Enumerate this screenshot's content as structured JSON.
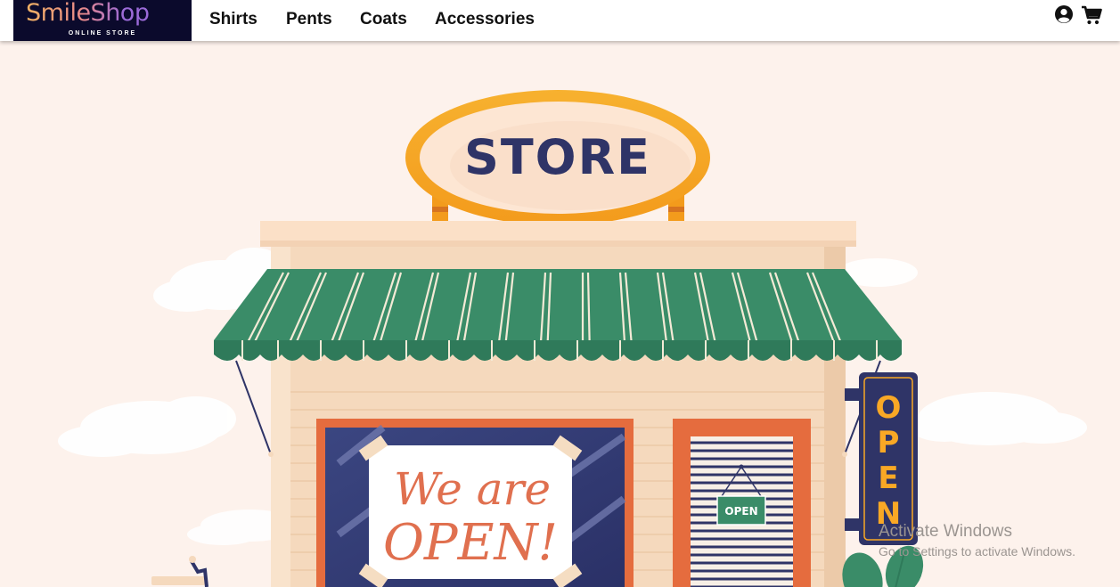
{
  "nav": {
    "logo_title": "SmileShop",
    "logo_subtitle": "ONLINE STORE",
    "links": [
      "Shirts",
      "Pents",
      "Coats",
      "Accessories"
    ],
    "icons": [
      "user-circle-icon",
      "cart-icon"
    ]
  },
  "hero": {
    "sign_text": "STORE",
    "poster_line1": "We are",
    "poster_line2": "OPEN!",
    "hanging_tag": "OPEN",
    "vertical_sign": [
      "O",
      "P",
      "E",
      "N"
    ]
  },
  "watermark": {
    "title": "Activate Windows",
    "subtitle": "Go to Settings to activate Windows."
  },
  "colors": {
    "background": "#fdf2ec",
    "awning_green": "#3a8c68",
    "sign_orange": "#f9a825",
    "navy": "#2f3467",
    "accent_orange": "#e56c3e"
  }
}
